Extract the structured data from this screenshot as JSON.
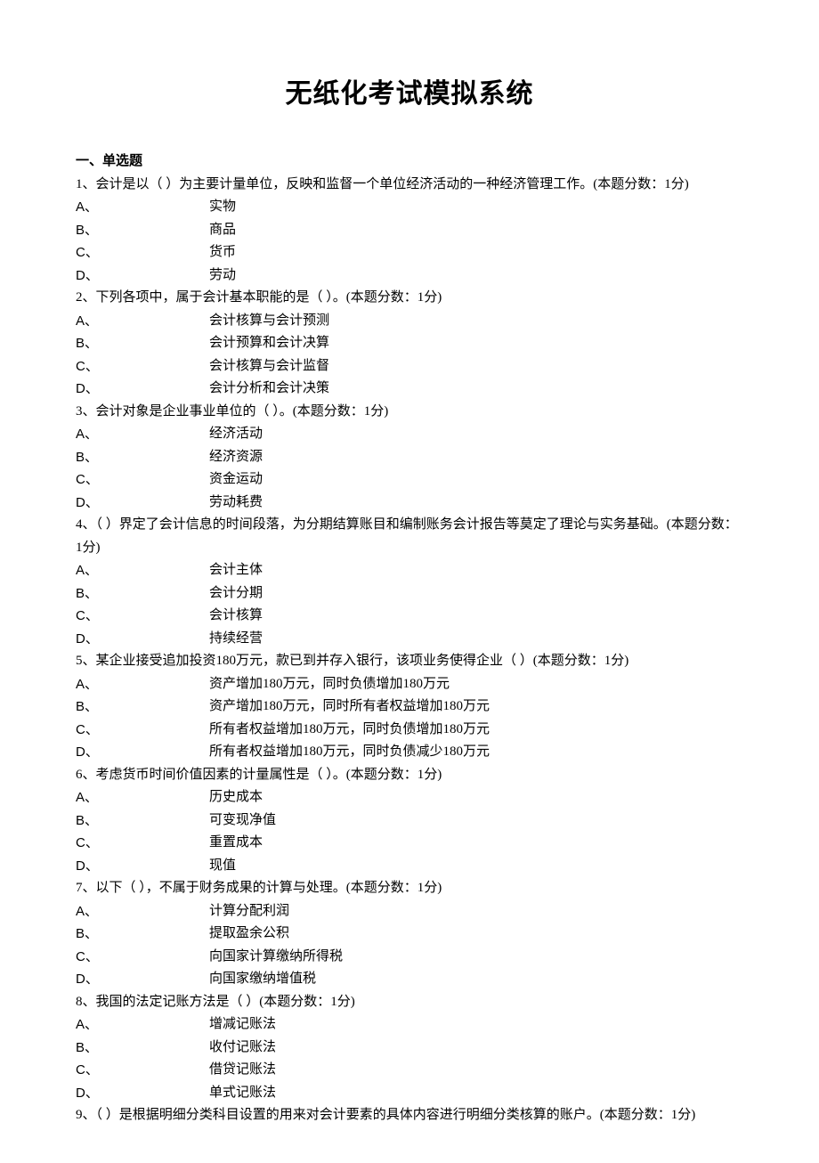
{
  "title": "无纸化考试模拟系统",
  "section_header": "一、单选题",
  "questions": [
    {
      "stem": "1、会计是以（  ）为主要计量单位，反映和监督一个单位经济活动的一种经济管理工作。(本题分数：1分)",
      "opts": {
        "A": "实物",
        "B": "商品",
        "C": "货币",
        "D": "劳动"
      }
    },
    {
      "stem": "2、下列各项中，属于会计基本职能的是（  ）。(本题分数：1分)",
      "opts": {
        "A": "会计核算与会计预测",
        "B": "会计预算和会计决算",
        "C": "会计核算与会计监督",
        "D": "会计分析和会计决策"
      }
    },
    {
      "stem": "3、会计对象是企业事业单位的（  ）。(本题分数：1分)",
      "opts": {
        "A": "经济活动",
        "B": "经济资源",
        "C": "资金运动",
        "D": "劳动耗费"
      }
    },
    {
      "stem": "4、（  ）界定了会计信息的时间段落，为分期结算账目和编制账务会计报告等莫定了理论与实务基础。(本题分数：1分)",
      "opts": {
        "A": "会计主体",
        "B": "会计分期",
        "C": "会计核算",
        "D": "持续经营"
      }
    },
    {
      "stem": "5、某企业接受追加投资180万元，款已到并存入银行，该项业务使得企业（  ）(本题分数：1分)",
      "opts": {
        "A": "资产增加180万元，同时负债增加180万元",
        "B": "资产增加180万元，同时所有者权益增加180万元",
        "C": "所有者权益增加180万元，同时负债增加180万元",
        "D": "所有者权益增加180万元，同时负债减少180万元"
      }
    },
    {
      "stem": "6、考虑货币时间价值因素的计量属性是（  ）。(本题分数：1分)",
      "opts": {
        "A": "历史成本",
        "B": "可变现净值",
        "C": "重置成本",
        "D": "现值"
      }
    },
    {
      "stem": "7、以下（  ），不属于财务成果的计算与处理。(本题分数：1分)",
      "opts": {
        "A": "计算分配利润",
        "B": "提取盈余公积",
        "C": "向国家计算缴纳所得税",
        "D": "向国家缴纳增值税"
      }
    },
    {
      "stem": "8、我国的法定记账方法是（  ）(本题分数：1分)",
      "opts": {
        "A": "增减记账法",
        "B": "收付记账法",
        "C": "借贷记账法",
        "D": "单式记账法"
      }
    },
    {
      "stem": "9、（  ）是根据明细分类科目设置的用来对会计要素的具体内容进行明细分类核算的账户。(本题分数：1分)"
    }
  ]
}
